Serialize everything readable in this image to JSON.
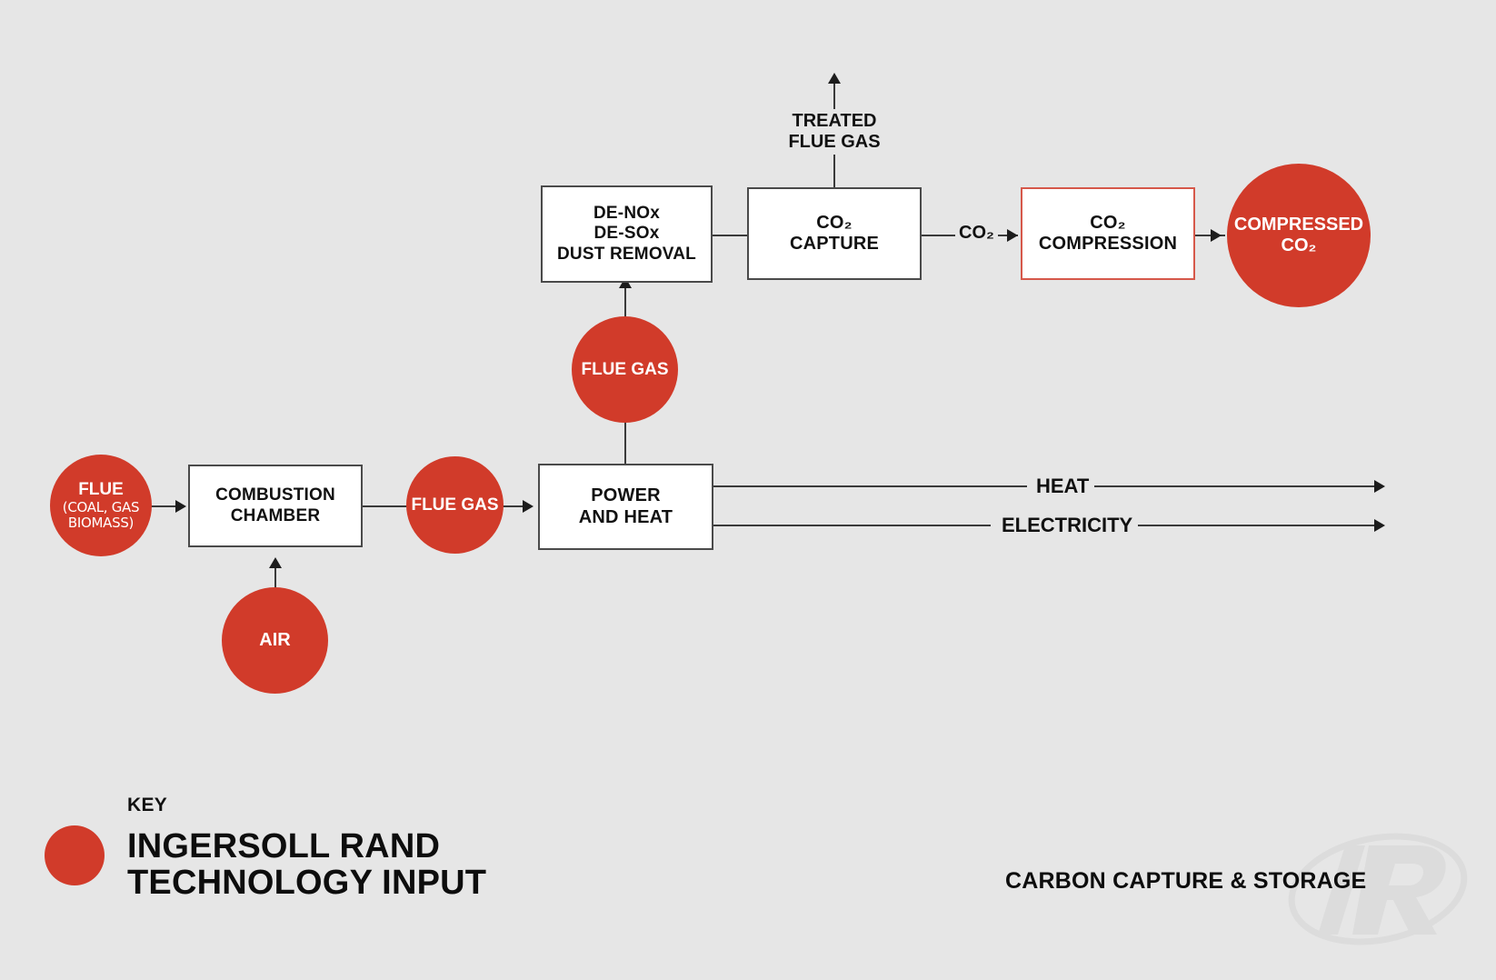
{
  "meta": {
    "background_color": "#e6e6e6",
    "accent_color": "#d13b2a",
    "accent_border_color": "#d6584a",
    "line_color": "#3a3a3a",
    "text_color": "#111111",
    "box_fill": "#ffffff"
  },
  "nodes": {
    "flue_input": {
      "label": "FLUE",
      "sublabel": "(COAL, GAS BIOMASS)",
      "type": "circle"
    },
    "combustion_chamber": {
      "line1": "COMBUSTION",
      "line2": "CHAMBER",
      "type": "box"
    },
    "air": {
      "label": "AIR",
      "type": "circle"
    },
    "flue_gas_1": {
      "label": "FLUE GAS",
      "type": "circle"
    },
    "power_and_heat": {
      "line1": "POWER",
      "line2": "AND HEAT",
      "type": "box"
    },
    "flue_gas_2": {
      "label": "FLUE GAS",
      "type": "circle"
    },
    "de_nox": {
      "line1": "DE-NOx",
      "line2": "DE-SOx",
      "line3": "DUST REMOVAL",
      "type": "box"
    },
    "co2_capture": {
      "line1": "CO₂",
      "line2": "CAPTURE",
      "type": "box"
    },
    "co2_compression": {
      "line1": "CO₂",
      "line2": "COMPRESSION",
      "type": "box",
      "border": "accent"
    },
    "compressed_co2": {
      "line1": "COMPRESSED",
      "line2": "CO₂",
      "type": "circle"
    }
  },
  "flow_labels": {
    "treated_flue_gas": {
      "line1": "TREATED",
      "line2": "FLUE GAS"
    },
    "co2_stream": "CO₂",
    "heat": "HEAT",
    "electricity": "ELECTRICITY"
  },
  "legend": {
    "heading": "KEY",
    "title_line1": "INGERSOLL RAND",
    "title_line2": "TECHNOLOGY INPUT",
    "swatch_color": "#d13b2a"
  },
  "footer": {
    "title": "CARBON CAPTURE & STORAGE",
    "watermark": "ir-logo-watermark"
  }
}
